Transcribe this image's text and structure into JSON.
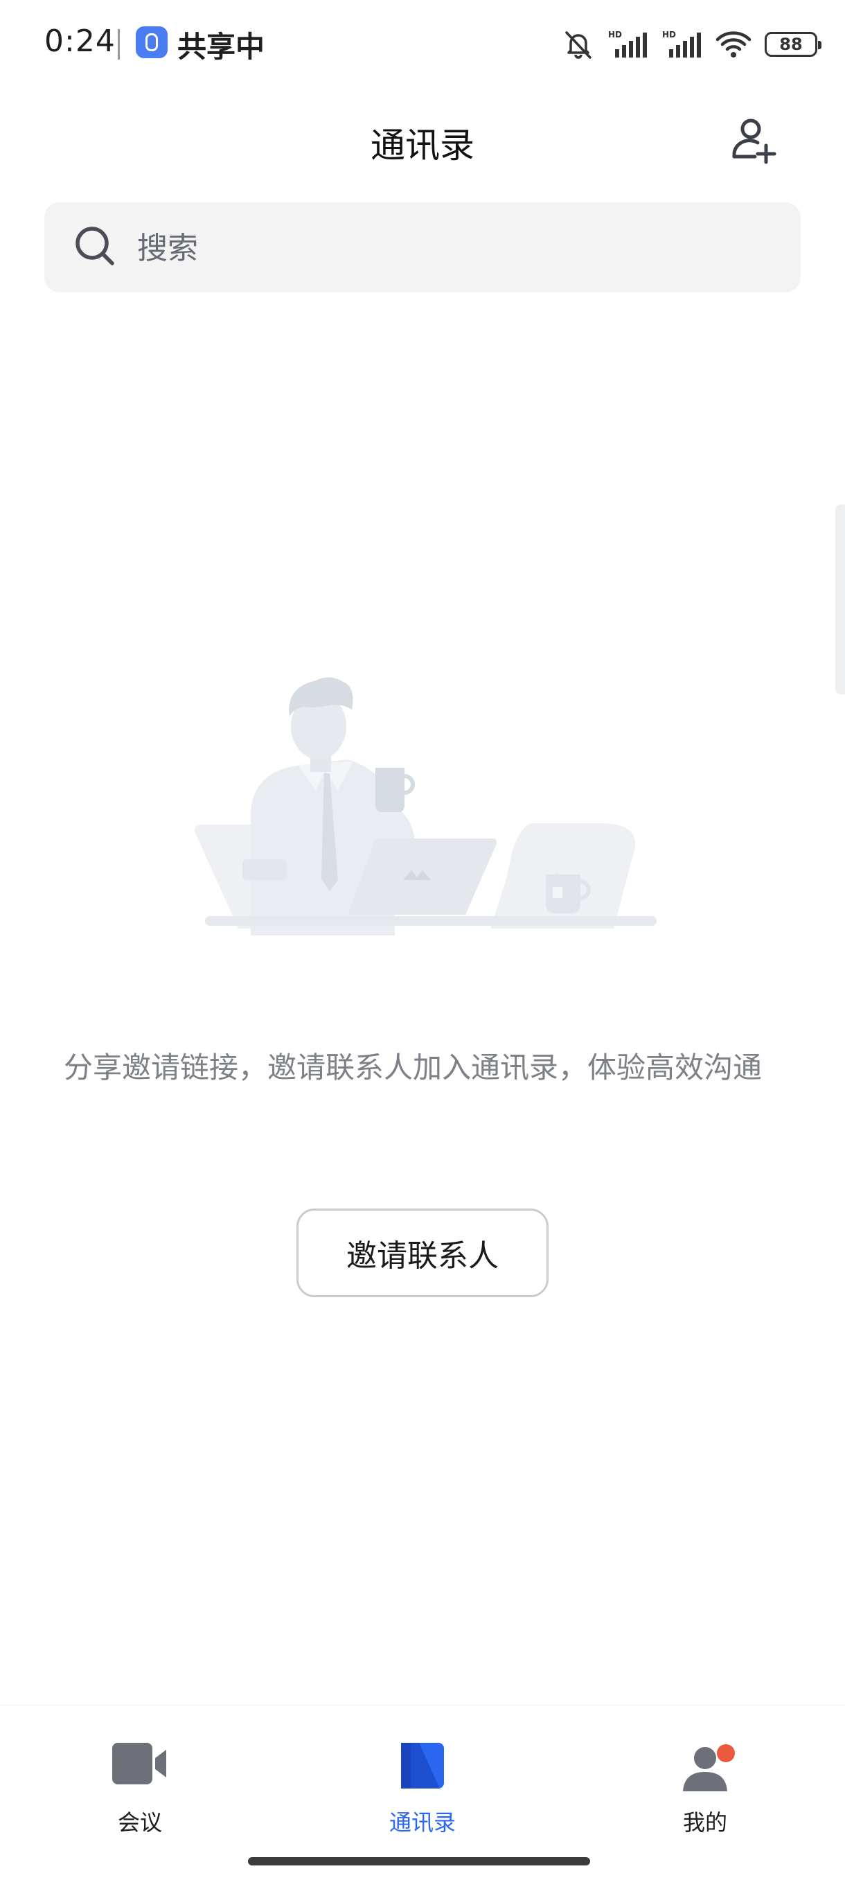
{
  "status_bar": {
    "time": "0:24",
    "sharing_label": "共享中",
    "battery_level": "88",
    "icons": [
      "mute-bell-icon",
      "signal-hd-icon",
      "signal-hd-icon",
      "wifi-icon",
      "battery-icon"
    ]
  },
  "header": {
    "title": "通讯录",
    "add_contact_icon": "add-contact-icon"
  },
  "search": {
    "placeholder": "搜索"
  },
  "empty_state": {
    "illustration": "person-at-desk-illustration",
    "message": "分享邀请链接，邀请联系人加入通讯录，体验高效沟通",
    "invite_button_label": "邀请联系人"
  },
  "bottom_nav": {
    "items": [
      {
        "label": "会议",
        "icon": "video-camera-icon",
        "active": false
      },
      {
        "label": "通讯录",
        "icon": "address-book-icon",
        "active": true
      },
      {
        "label": "我的",
        "icon": "profile-icon",
        "active": false,
        "badge": true
      }
    ]
  },
  "colors": {
    "accent": "#2b66f0",
    "badge": "#ec5a3e",
    "search_bg": "#f3f3f4",
    "muted_text": "#7d8087",
    "inactive_icon": "#6e7079"
  }
}
